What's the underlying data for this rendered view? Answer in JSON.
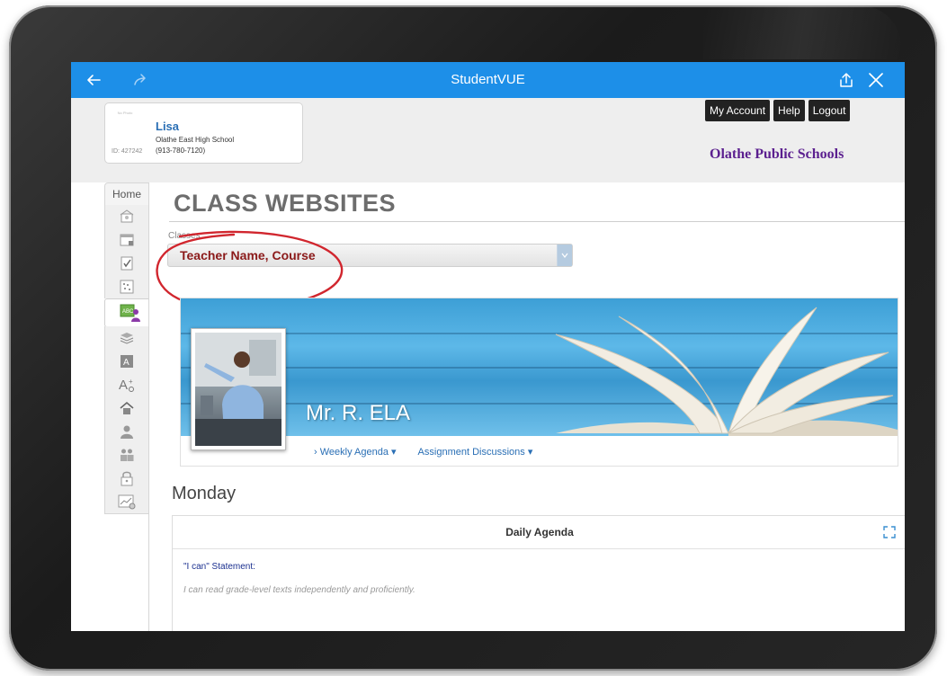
{
  "app": {
    "title": "StudentVUE"
  },
  "student": {
    "photo_placeholder": "No Photo",
    "name": "Lisa",
    "school": "Olathe East High School",
    "phone": "(913-780-7120)",
    "id_label": "ID: 427242"
  },
  "header": {
    "links": [
      "My Account",
      "Help",
      "Logout"
    ],
    "district": "Olathe Public Schools"
  },
  "side_menu": {
    "home_label": "Home",
    "icons": [
      "school-icon",
      "calendar-icon",
      "grade-book-icon",
      "attendance-icon",
      "class-websites-icon",
      "course-history-icon",
      "report-card-icon",
      "test-history-icon",
      "school-info-icon",
      "student-info-icon",
      "contacts-icon",
      "lock-icon",
      "chart-icon"
    ]
  },
  "main": {
    "page_title": "CLASS WEBSITES",
    "classes_label": "Classes",
    "selected_class": "Teacher Name, Course",
    "banner": {
      "teacher_name": "Mr. R. ELA",
      "nav": [
        "› Weekly Agenda ▾",
        "Assignment Discussions ▾"
      ]
    },
    "day": "Monday",
    "agenda": {
      "title": "Daily Agenda",
      "statement_label": "\"I can\" Statement:",
      "statement_text": "I can read grade-level texts independently and proficiently."
    }
  },
  "colors": {
    "nav_bar": "#1d8fe8",
    "district": "#5b1f8f",
    "student_name": "#2a6fb5",
    "selected_class": "#8b1a1a",
    "highlight_circle": "#d1262e"
  }
}
